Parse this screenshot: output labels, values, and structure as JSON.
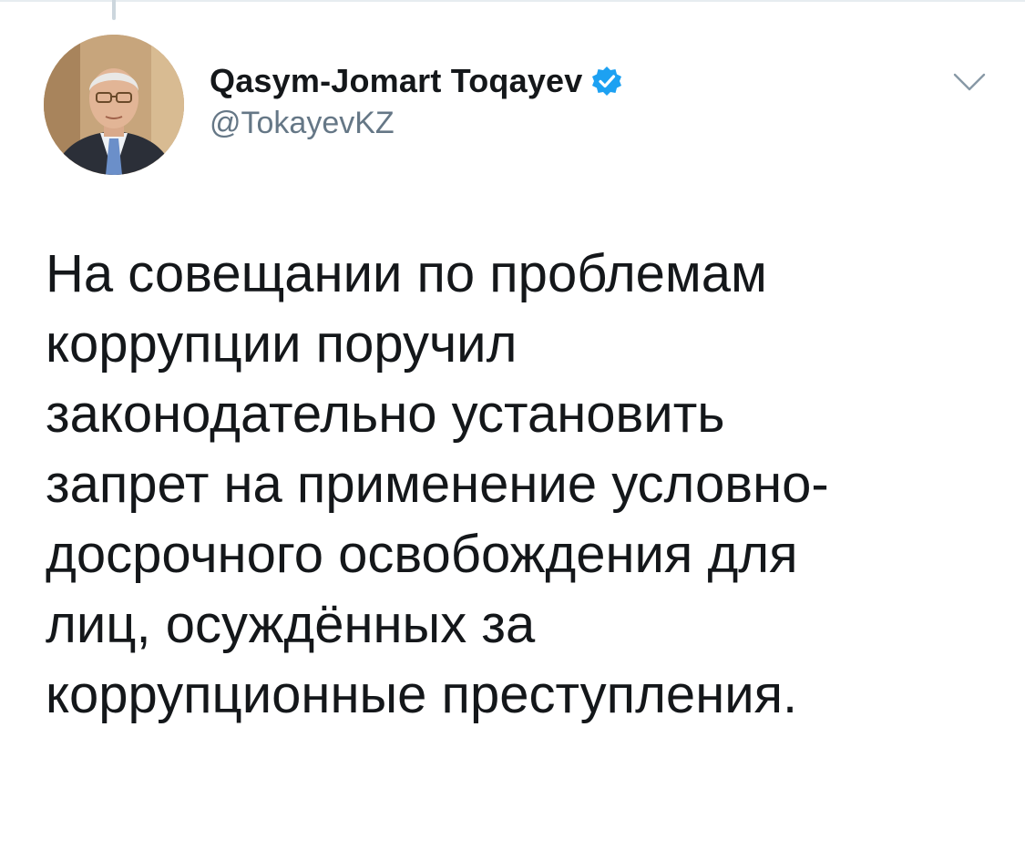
{
  "tweet": {
    "author": {
      "display_name": "Qasym-Jomart Toqayev",
      "handle": "@TokayevKZ",
      "verified": true,
      "avatar_icon": "profile-photo"
    },
    "text": "На совещании по проблемам\nкоррупции поручил\nзаконодательно установить\nзапрет на применение условно-\nдосрочного освобождения для\nлиц, осуждённых за\nкоррупционные преступления.",
    "menu_icon": "chevron-down-icon",
    "verified_icon": "verified-badge-icon"
  },
  "colors": {
    "text_primary": "#14171a",
    "text_secondary": "#657786",
    "verified_blue": "#1da1f2",
    "divider": "#e6ecf0",
    "thread_line": "#ccd6dd"
  }
}
